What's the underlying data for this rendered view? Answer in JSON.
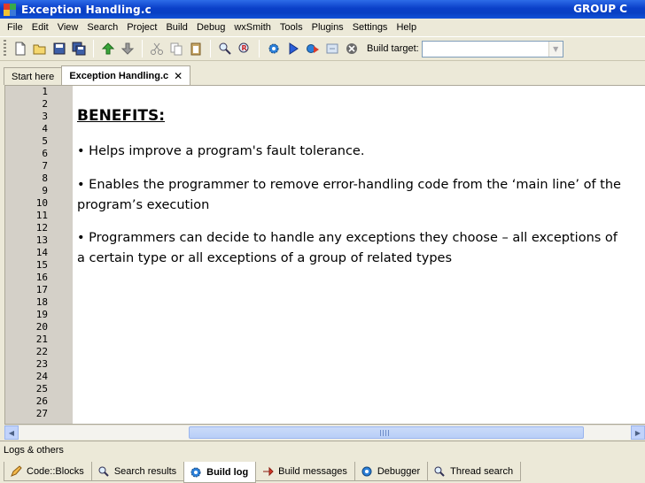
{
  "window": {
    "title": "Exception Handling.c",
    "group_label": "GROUP C"
  },
  "menu": [
    "File",
    "Edit",
    "View",
    "Search",
    "Project",
    "Build",
    "Debug",
    "wxSmith",
    "Tools",
    "Plugins",
    "Settings",
    "Help"
  ],
  "toolbar": {
    "build_target_label": "Build target:",
    "build_target_value": ""
  },
  "editor": {
    "tabs": [
      {
        "label": "Start here"
      },
      {
        "label": "Exception Handling.c"
      }
    ],
    "line_numbers": [
      "1",
      "2",
      "3",
      "4",
      "5",
      "6",
      "7",
      "8",
      "9",
      "10",
      "11",
      "12",
      "13",
      "14",
      "15",
      "16",
      "17",
      "18",
      "19",
      "20",
      "21",
      "22",
      "23",
      "24",
      "25",
      "26",
      "27"
    ],
    "heading": "BENEFITS:",
    "bullets": [
      "• Helps improve a program's fault tolerance.",
      "• Enables the programmer to remove error-handling code from the ‘main line’ of the program’s execution",
      "• Programmers can decide to handle any exceptions they choose – all exceptions of a certain type or all exceptions of a group of related types"
    ]
  },
  "logs": {
    "title": "Logs & others",
    "tabs": [
      {
        "label": "Code::Blocks",
        "icon": "pencil-icon"
      },
      {
        "label": "Search results",
        "icon": "magnifier-icon"
      },
      {
        "label": "Build log",
        "icon": "gear-icon",
        "active": true
      },
      {
        "label": "Build messages",
        "icon": "arrow-icon"
      },
      {
        "label": "Debugger",
        "icon": "gear-icon"
      },
      {
        "label": "Thread search",
        "icon": "magnifier-icon"
      }
    ]
  }
}
